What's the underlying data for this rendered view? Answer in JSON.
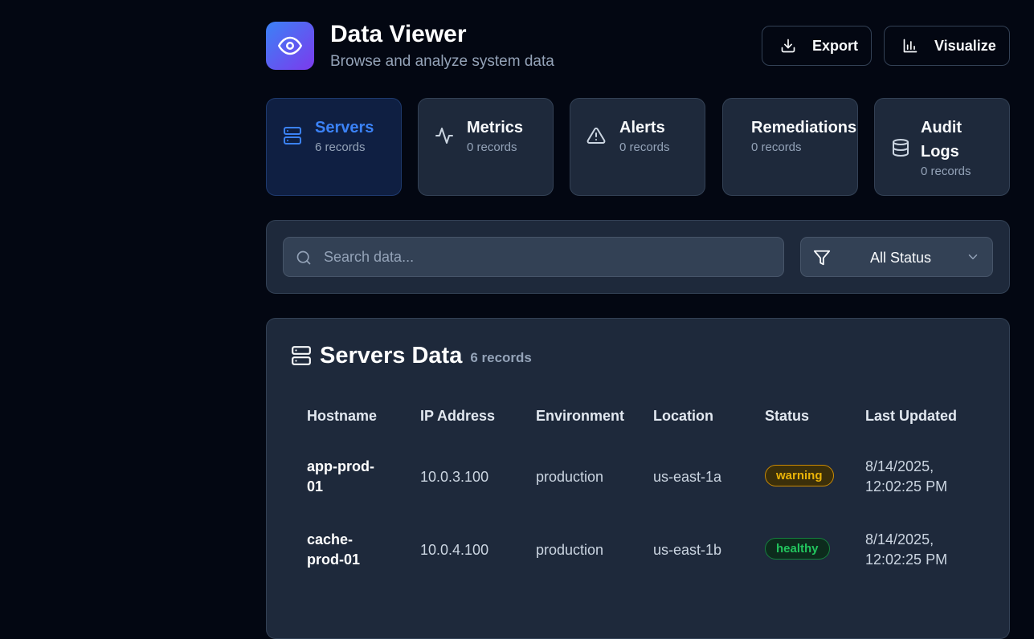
{
  "header": {
    "title": "Data Viewer",
    "subtitle": "Browse and analyze system data",
    "logo_icon": "eye-icon",
    "export_label": "Export",
    "visualize_label": "Visualize"
  },
  "tabs": [
    {
      "label": "Servers",
      "count": "6 records",
      "icon": "server-icon",
      "active": true
    },
    {
      "label": "Metrics",
      "count": "0 records",
      "icon": "activity-icon",
      "active": false
    },
    {
      "label": "Alerts",
      "count": "0 records",
      "icon": "alert-triangle-icon",
      "active": false
    },
    {
      "label": "Remediations",
      "count": "0 records",
      "icon": "wrench-icon",
      "active": false
    },
    {
      "label": "Audit Logs",
      "label_line1": "Audit",
      "label_line2": "Logs",
      "count": "0 records",
      "icon": "database-icon",
      "active": false
    }
  ],
  "filters": {
    "search_placeholder": "Search data...",
    "search_value": "",
    "status_selected": "All Status"
  },
  "table": {
    "title": "Servers Data",
    "count": "6 records",
    "columns": [
      "Hostname",
      "IP Address",
      "Environment",
      "Location",
      "Status",
      "Last Updated"
    ],
    "rows": [
      {
        "hostname_line1": "app-prod-",
        "hostname_line2": "01",
        "ip": "10.0.3.100",
        "environment": "production",
        "location": "us-east-1a",
        "status": "warning",
        "updated_line1": "8/14/2025,",
        "updated_line2": "12:02:25 PM"
      },
      {
        "hostname_line1": "cache-",
        "hostname_line2": "prod-01",
        "ip": "10.0.4.100",
        "environment": "production",
        "location": "us-east-1b",
        "status": "healthy",
        "updated_line1": "8/14/2025,",
        "updated_line2": "12:02:25 PM"
      }
    ]
  },
  "colors": {
    "background": "#030712",
    "card": "#1e293b",
    "accent": "#3b82f6",
    "warning": "#eab308",
    "healthy": "#22c55e"
  }
}
